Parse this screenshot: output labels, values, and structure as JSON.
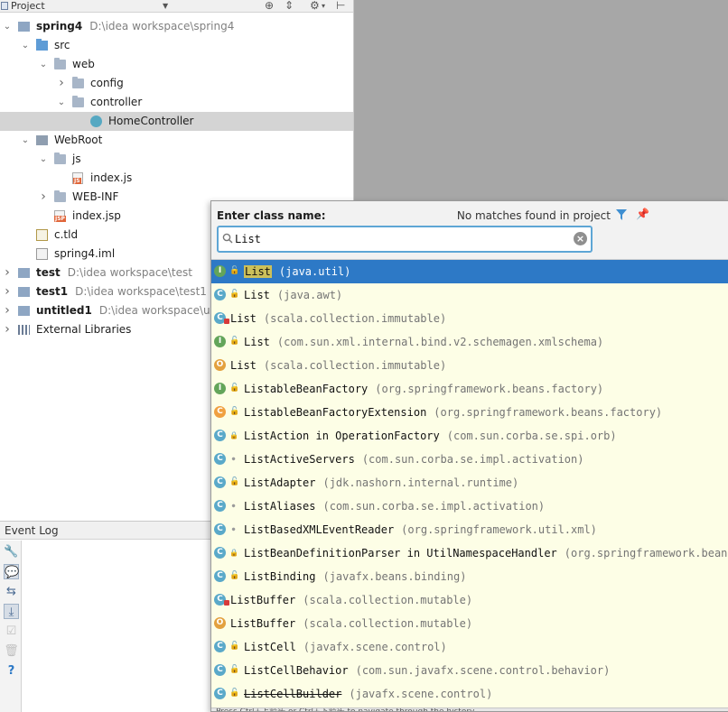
{
  "project_panel": {
    "header": {
      "title": "Project"
    },
    "tree": [
      {
        "label": "spring4",
        "path": "D:\\idea workspace\\spring4",
        "bold": true,
        "expanded": true,
        "icon": "module-icon",
        "depth": 0
      },
      {
        "label": "src",
        "expanded": true,
        "icon": "source-folder-icon",
        "depth": 1
      },
      {
        "label": "web",
        "expanded": true,
        "icon": "package-icon",
        "depth": 2
      },
      {
        "label": "config",
        "expanded": false,
        "icon": "package-icon",
        "depth": 3
      },
      {
        "label": "controller",
        "expanded": true,
        "icon": "package-icon",
        "depth": 3
      },
      {
        "label": "HomeController",
        "icon": "class-icon",
        "depth": 4,
        "selected": true
      },
      {
        "label": "WebRoot",
        "expanded": true,
        "icon": "web-folder-icon",
        "depth": 1
      },
      {
        "label": "js",
        "expanded": true,
        "icon": "folder-icon",
        "depth": 2
      },
      {
        "label": "index.js",
        "icon": "js-file-icon",
        "depth": 3
      },
      {
        "label": "WEB-INF",
        "expanded": false,
        "icon": "folder-icon",
        "depth": 2
      },
      {
        "label": "index.jsp",
        "icon": "jsp-file-icon",
        "depth": 2
      },
      {
        "label": "c.tld",
        "icon": "tld-file-icon",
        "depth": 1
      },
      {
        "label": "spring4.iml",
        "icon": "iml-file-icon",
        "depth": 1
      },
      {
        "label": "test",
        "path": "D:\\idea workspace\\test",
        "bold": true,
        "expanded": false,
        "icon": "module-icon",
        "depth": 0
      },
      {
        "label": "test1",
        "path": "D:\\idea workspace\\test1",
        "bold": true,
        "expanded": false,
        "icon": "module-icon",
        "depth": 0
      },
      {
        "label": "untitled1",
        "path": "D:\\idea workspace\\un",
        "bold": true,
        "expanded": false,
        "icon": "module-icon",
        "depth": 0
      },
      {
        "label": "External Libraries",
        "expanded": false,
        "icon": "library-icon",
        "depth": 0
      }
    ]
  },
  "event_log": {
    "title": "Event Log",
    "tools": [
      "wrench-icon",
      "balloon-icon",
      "soft-wrap-icon",
      "scroll-to-end-icon",
      "mark-read-icon",
      "trash-icon",
      "help-icon"
    ]
  },
  "popup": {
    "prompt": "Enter class name:",
    "status": "No matches found in project",
    "search_value": "List",
    "results": [
      {
        "kind": "I",
        "vis": "public",
        "name": "List",
        "pkg": "(java.util)",
        "selected": true,
        "highlight": true
      },
      {
        "kind": "C",
        "vis": "public",
        "name": "List",
        "pkg": "(java.awt)"
      },
      {
        "kind": "C",
        "vis": "scala",
        "name": "List",
        "pkg": "(scala.collection.immutable)"
      },
      {
        "kind": "I",
        "vis": "public",
        "name": "List",
        "pkg": "(com.sun.xml.internal.bind.v2.schemagen.xmlschema)"
      },
      {
        "kind": "O",
        "vis": "none",
        "name": "List",
        "pkg": "(scala.collection.immutable)"
      },
      {
        "kind": "I",
        "vis": "public",
        "name": "ListableBeanFactory",
        "pkg": "(org.springframework.beans.factory)"
      },
      {
        "kind": "E",
        "vis": "public",
        "name": "ListableBeanFactoryExtension",
        "pkg": "(org.springframework.beans.factory)"
      },
      {
        "kind": "C",
        "vis": "private",
        "name": "ListAction in OperationFactory",
        "pkg": "(com.sun.corba.se.spi.orb)"
      },
      {
        "kind": "C",
        "vis": "package",
        "name": "ListActiveServers",
        "pkg": "(com.sun.corba.se.impl.activation)"
      },
      {
        "kind": "C",
        "vis": "public",
        "name": "ListAdapter",
        "pkg": "(jdk.nashorn.internal.runtime)"
      },
      {
        "kind": "C",
        "vis": "package",
        "name": "ListAliases",
        "pkg": "(com.sun.corba.se.impl.activation)"
      },
      {
        "kind": "C",
        "vis": "package",
        "name": "ListBasedXMLEventReader",
        "pkg": "(org.springframework.util.xml)"
      },
      {
        "kind": "C",
        "vis": "private",
        "name": "ListBeanDefinitionParser in UtilNamespaceHandler",
        "pkg": "(org.springframework.beans.f"
      },
      {
        "kind": "C",
        "vis": "public",
        "name": "ListBinding",
        "pkg": "(javafx.beans.binding)"
      },
      {
        "kind": "C",
        "vis": "scala",
        "name": "ListBuffer",
        "pkg": "(scala.collection.mutable)"
      },
      {
        "kind": "O",
        "vis": "none",
        "name": "ListBuffer",
        "pkg": "(scala.collection.mutable)"
      },
      {
        "kind": "C",
        "vis": "public",
        "name": "ListCell",
        "pkg": "(javafx.scene.control)"
      },
      {
        "kind": "C",
        "vis": "public",
        "name": "ListCellBehavior",
        "pkg": "(com.sun.javafx.scene.control.behavior)"
      },
      {
        "kind": "C",
        "vis": "public",
        "name": "ListCellBuilder",
        "pkg": "(javafx.scene.control)",
        "deprecated": true
      }
    ],
    "footer": "Press Ctrl+上箭头 or Ctrl+下箭头 to navigate through the history"
  },
  "colors": {
    "selection": "#2d79c6",
    "results_background": "#fdfee6",
    "search_border": "#5ea6d5"
  }
}
